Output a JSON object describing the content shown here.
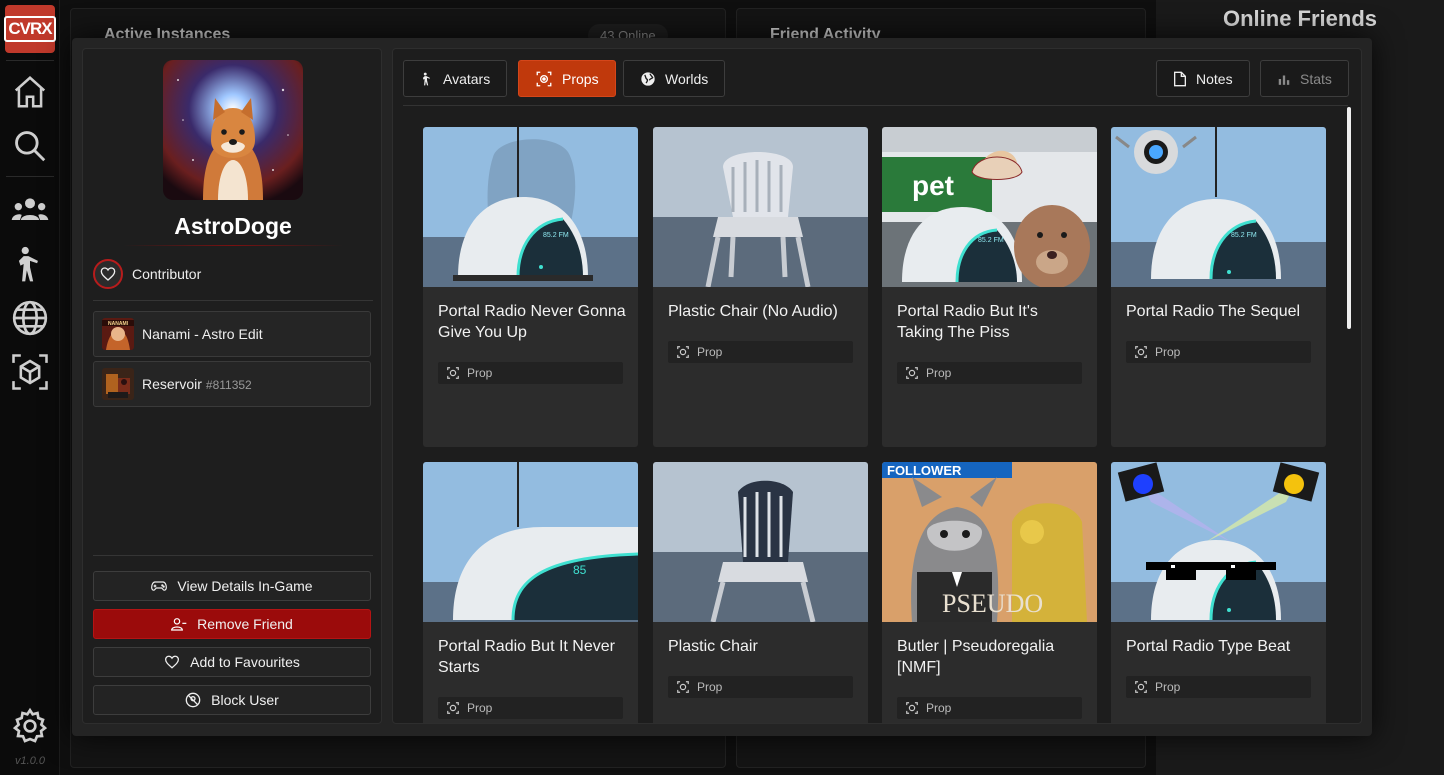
{
  "app": {
    "logo": "CVRX",
    "version": "v1.0.0"
  },
  "rail_icons": [
    "home-icon",
    "search-icon",
    "friends-icon",
    "avatar-icon",
    "worlds-icon",
    "props-icon",
    "settings-icon"
  ],
  "background": {
    "active_instances_title": "Active Instances",
    "online_count": "43 Online",
    "friend_activity_title": "Friend Activity",
    "online_friends_title": "Online Friends"
  },
  "profile": {
    "username": "AstroDoge",
    "badge": "Contributor",
    "groups": [
      {
        "name": "Nanami - Astro Edit",
        "tag": "",
        "thumb_label": "NANAMI"
      },
      {
        "name": "Reservoir",
        "tag": "#811352",
        "thumb_label": ""
      }
    ],
    "buttons": {
      "view_details": "View Details In-Game",
      "remove_friend": "Remove Friend",
      "add_favourites": "Add to Favourites",
      "block_user": "Block User"
    }
  },
  "tabs": {
    "avatars": "Avatars",
    "props": "Props",
    "worlds": "Worlds",
    "notes": "Notes",
    "stats": "Stats",
    "active": "Props"
  },
  "cards": [
    {
      "title": "Portal Radio Never Gonna Give You Up",
      "type": "Prop",
      "radio_label": "85.2 FM"
    },
    {
      "title": "Plastic Chair (No Audio)",
      "type": "Prop"
    },
    {
      "title": "Portal Radio But It's Taking The Piss",
      "type": "Prop",
      "radio_label": "85.2 FM",
      "sign_text": "pet"
    },
    {
      "title": "Portal Radio The Sequel",
      "type": "Prop",
      "radio_label": "85.2 FM"
    },
    {
      "title": "Portal Radio But It Never Starts",
      "type": "Prop",
      "radio_label": "85"
    },
    {
      "title": "Plastic Chair",
      "type": "Prop"
    },
    {
      "title": "Butler | Pseudoregalia [NMF]",
      "type": "Prop",
      "banner_text": "FOLLOWER",
      "logo_text": "PSEUDO"
    },
    {
      "title": "Portal Radio Type Beat",
      "type": "Prop"
    }
  ],
  "colors": {
    "accent": "#c0390c",
    "danger": "#9b0b0b",
    "radio_glow": "#3fe0d0"
  }
}
